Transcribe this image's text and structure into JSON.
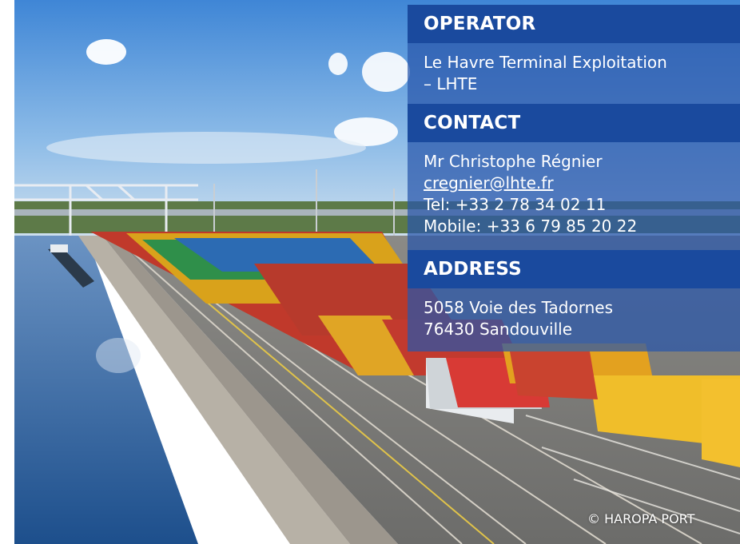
{
  "operator": {
    "heading": "OPERATOR",
    "line1": "Le Havre Terminal Exploitation",
    "line2": "– LHTE"
  },
  "contact": {
    "heading": "CONTACT",
    "name": "Mr Christophe Régnier",
    "email": "cregnier@lhte.fr",
    "tel": "Tel: +33 2 78 34 02 11",
    "mobile": "Mobile: +33 6 79 85 20 22"
  },
  "address": {
    "heading": "ADDRESS",
    "line1": "5058 Voie des Tadornes",
    "line2": "76430 Sandouville"
  },
  "credit": "© HAROPA PORT",
  "colors": {
    "header_blue": "#1a4a9e",
    "panel_blue": "#2856aa"
  }
}
